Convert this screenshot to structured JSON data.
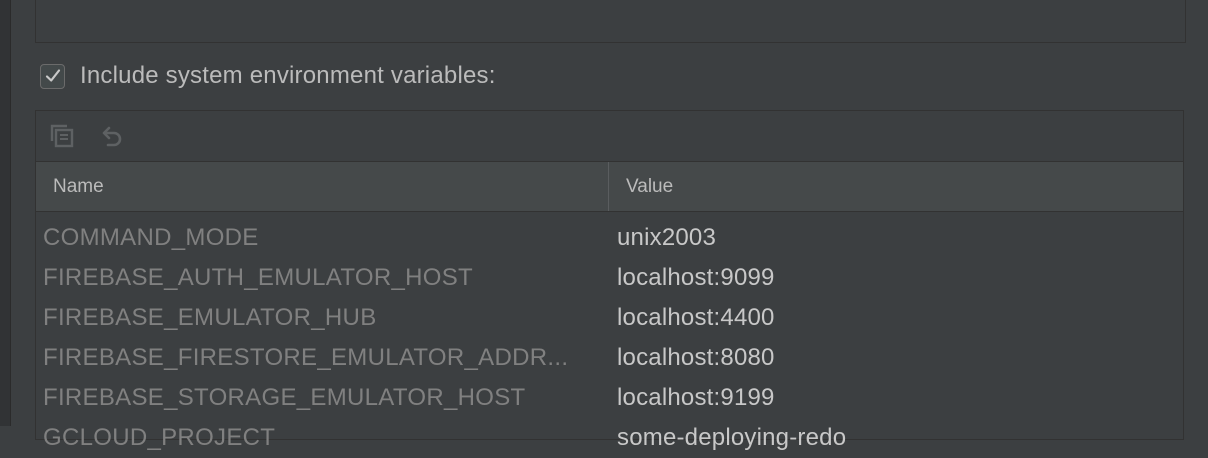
{
  "include_system_env": {
    "label": "Include system environment variables:",
    "checked": true
  },
  "toolbar": {
    "copy_icon": "copy-icon",
    "revert_icon": "undo-icon"
  },
  "table": {
    "columns": [
      "Name",
      "Value"
    ],
    "rows": [
      {
        "name": "COMMAND_MODE",
        "value": "unix2003"
      },
      {
        "name": "FIREBASE_AUTH_EMULATOR_HOST",
        "value": "localhost:9099"
      },
      {
        "name": "FIREBASE_EMULATOR_HUB",
        "value": "localhost:4400"
      },
      {
        "name": "FIREBASE_FIRESTORE_EMULATOR_ADDR...",
        "value": "localhost:8080"
      },
      {
        "name": "FIREBASE_STORAGE_EMULATOR_HOST",
        "value": "localhost:9199"
      },
      {
        "name": "GCLOUD_PROJECT",
        "value": "some-deploying-redo"
      }
    ]
  },
  "colors": {
    "background": "#3c3f41",
    "header": "#45494a",
    "name_text": "#808080",
    "value_text": "#c8c8c8"
  }
}
